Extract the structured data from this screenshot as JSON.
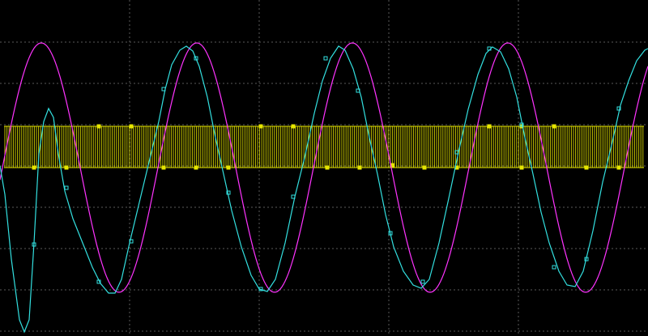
{
  "screen": {
    "title": "",
    "background": "#000000",
    "grid_color": "#5a5a5a"
  },
  "traces": [
    {
      "id": "magenta",
      "color": "#ff33ff"
    },
    {
      "id": "cyan",
      "color": "#33e0e0"
    },
    {
      "id": "yellow-pulse",
      "color": "#e6e600"
    }
  ]
}
